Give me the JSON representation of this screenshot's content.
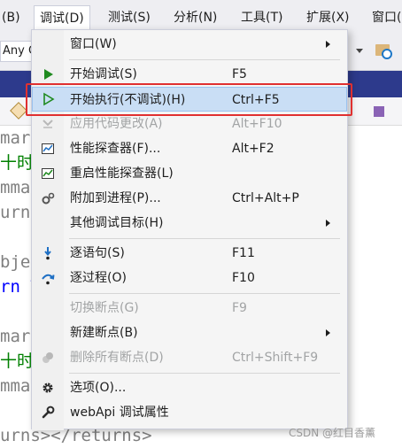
{
  "menubar": {
    "items": [
      {
        "label": "(B)"
      },
      {
        "label": "调试(D)"
      },
      {
        "label": "测试(S)"
      },
      {
        "label": "分析(N)"
      },
      {
        "label": "工具(T)"
      },
      {
        "label": "扩展(X)"
      },
      {
        "label": "窗口("
      }
    ]
  },
  "toolbar": {
    "config_combo": "Any C"
  },
  "code_lines": [
    {
      "text": "mary",
      "color": "gray"
    },
    {
      "text": "十时",
      "color": "green"
    },
    {
      "text": "mmar",
      "color": "gray"
    },
    {
      "text": "urns",
      "color": "gray"
    },
    {
      "text": "",
      "color": "gray"
    },
    {
      "text": "bjec",
      "color": "gray"
    },
    {
      "text": "rn T",
      "color": "blue"
    },
    {
      "text": "",
      "color": "gray"
    },
    {
      "text": "mary",
      "color": "gray"
    },
    {
      "text": "十时",
      "color": "green"
    },
    {
      "text": "mmar",
      "color": "gray"
    },
    {
      "text": "urns></returns>",
      "color": "gray"
    }
  ],
  "debug_menu": {
    "items": [
      {
        "label": "窗口(W)",
        "shortcut": "",
        "submenu": true,
        "disabled": false,
        "icon": ""
      },
      {
        "label": "开始调试(S)",
        "shortcut": "F5",
        "submenu": false,
        "disabled": false,
        "icon": "play-icon"
      },
      {
        "label": "开始执行(不调试)(H)",
        "shortcut": "Ctrl+F5",
        "submenu": false,
        "disabled": false,
        "icon": "play-outline-icon",
        "highlighted": true
      },
      {
        "label": "应用代码更改(A)",
        "shortcut": "Alt+F10",
        "submenu": false,
        "disabled": true,
        "icon": "apply-code-changes-icon"
      },
      {
        "label": "性能探查器(F)...",
        "shortcut": "Alt+F2",
        "submenu": false,
        "disabled": false,
        "icon": "performance-profiler-icon"
      },
      {
        "label": "重启性能探查器(L)",
        "shortcut": "",
        "submenu": false,
        "disabled": false,
        "icon": "relaunch-profiler-icon"
      },
      {
        "label": "附加到进程(P)...",
        "shortcut": "Ctrl+Alt+P",
        "submenu": false,
        "disabled": false,
        "icon": "attach-process-icon"
      },
      {
        "label": "其他调试目标(H)",
        "shortcut": "",
        "submenu": true,
        "disabled": false,
        "icon": ""
      },
      {
        "label": "逐语句(S)",
        "shortcut": "F11",
        "submenu": false,
        "disabled": false,
        "icon": "step-into-icon"
      },
      {
        "label": "逐过程(O)",
        "shortcut": "F10",
        "submenu": false,
        "disabled": false,
        "icon": "step-over-icon"
      },
      {
        "label": "切换断点(G)",
        "shortcut": "F9",
        "submenu": false,
        "disabled": true,
        "icon": ""
      },
      {
        "label": "新建断点(B)",
        "shortcut": "",
        "submenu": true,
        "disabled": false,
        "icon": ""
      },
      {
        "label": "删除所有断点(D)",
        "shortcut": "Ctrl+Shift+F9",
        "submenu": false,
        "disabled": true,
        "icon": "delete-breakpoints-icon"
      },
      {
        "label": "选项(O)...",
        "shortcut": "",
        "submenu": false,
        "disabled": false,
        "icon": "gear-icon"
      },
      {
        "label": "webApi 调试属性",
        "shortcut": "",
        "submenu": false,
        "disabled": false,
        "icon": "wrench-icon"
      }
    ]
  },
  "watermark": "CSDN @红目香薰",
  "colors": {
    "highlight_bg": "#c9def5",
    "annotation_red": "#e03030",
    "play_green": "#1f8a1f",
    "step_blue": "#1e6fc4"
  }
}
